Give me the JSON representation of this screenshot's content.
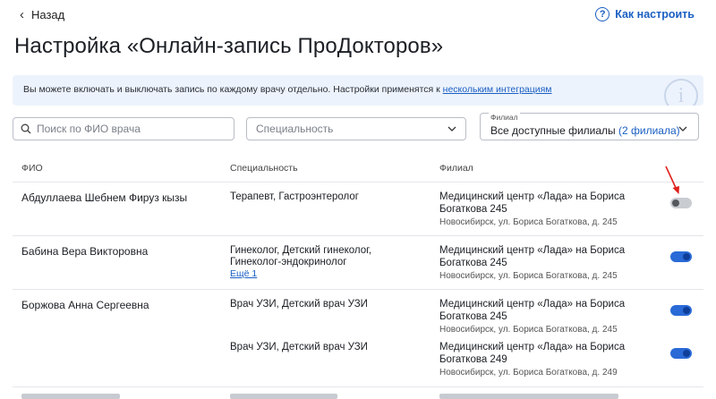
{
  "header": {
    "back_label": "Назад",
    "help_label": "Как настроить"
  },
  "page_title": "Настройка «Онлайн-запись ПроДокторов»",
  "notice": {
    "text": "Вы можете включать и выключать запись по каждому врачу отдельно. Настройки применятся к ",
    "link": "нескольким интеграциям"
  },
  "filters": {
    "search_placeholder": "Поиск по ФИО врача",
    "specialty_placeholder": "Специальность",
    "branch_label": "Филиал",
    "branch_value": "Все доступные филиалы",
    "branch_count": "(2 филиала)"
  },
  "table": {
    "columns": [
      "ФИО",
      "Специальность",
      "Филиал"
    ],
    "rows": [
      {
        "name": "Абдуллаева Шебнем Фируз кызы",
        "entries": [
          {
            "specialty": "Терапевт, Гастроэнтеролог",
            "more": "",
            "branch": "Медицинский центр «Лада» на Бориса Богаткова 245",
            "address": "Новосибирск, ул. Бориса Богаткова, д. 245",
            "enabled": false
          }
        ]
      },
      {
        "name": "Бабина Вера Викторовна",
        "entries": [
          {
            "specialty": "Гинеколог, Детский гинеколог, Гинеколог-эндокринолог",
            "more": "Ещё 1",
            "branch": "Медицинский центр «Лада» на Бориса Богаткова 245",
            "address": "Новосибирск, ул. Бориса Богаткова, д. 245",
            "enabled": true
          }
        ]
      },
      {
        "name": "Боржова Анна Сергеевна",
        "entries": [
          {
            "specialty": "Врач УЗИ, Детский врач УЗИ",
            "more": "",
            "branch": "Медицинский центр «Лада» на Бориса Богаткова 245",
            "address": "Новосибирск, ул. Бориса Богаткова, д. 245",
            "enabled": true
          },
          {
            "specialty": "Врач УЗИ, Детский врач УЗИ",
            "more": "",
            "branch": "Медицинский центр «Лада» на Бориса Богаткова 249",
            "address": "Новосибирск, ул. Бориса Богаткова, д. 249",
            "enabled": true
          }
        ]
      }
    ]
  },
  "colors": {
    "accent": "#1a5fc2",
    "toggle_on": "#2a6ad6",
    "toggle_off": "#c9ccd1",
    "notice_bg": "#edf3fc",
    "annotation_arrow": "#e0201b"
  }
}
